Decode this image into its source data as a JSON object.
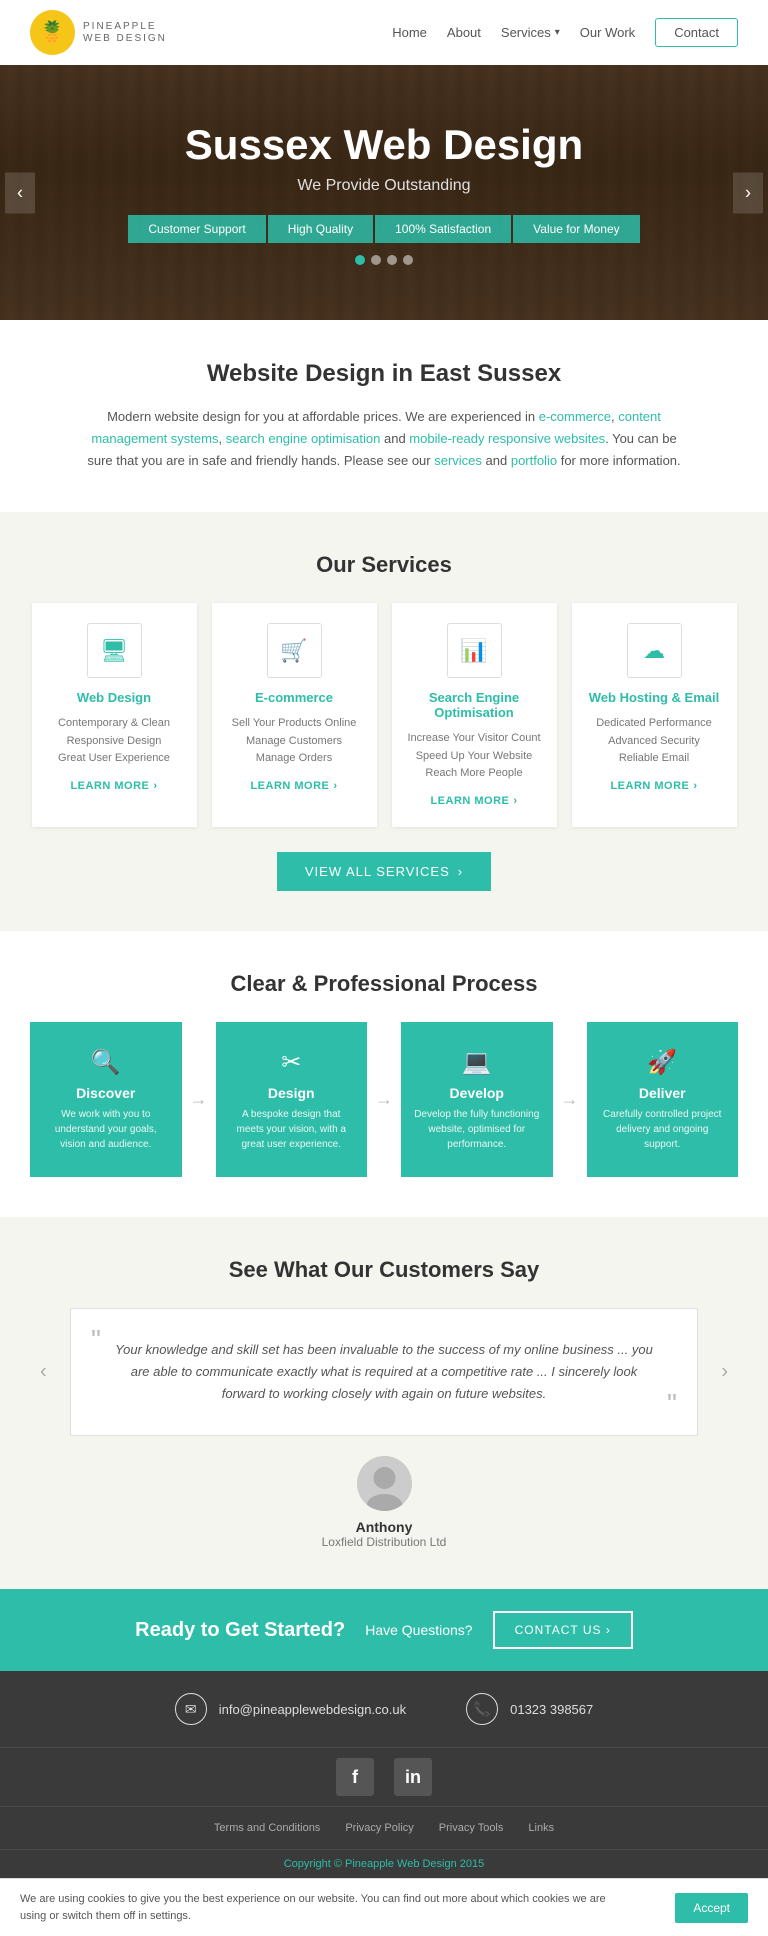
{
  "nav": {
    "logo_text": "PINEAPPLE",
    "logo_subtext": "WEB DESIGN",
    "logo_emoji": "🍍",
    "links": [
      {
        "label": "Home",
        "href": "#"
      },
      {
        "label": "About",
        "href": "#"
      },
      {
        "label": "Services",
        "href": "#"
      },
      {
        "label": "Our Work",
        "href": "#"
      }
    ],
    "contact_label": "Contact"
  },
  "hero": {
    "title": "Sussex Web Design",
    "subtitle": "We Provide Outstanding",
    "badges": [
      "Customer Support",
      "High Quality",
      "100% Satisfaction",
      "Value for Money"
    ],
    "prev_label": "‹",
    "next_label": "›"
  },
  "about": {
    "title": "Website Design in East Sussex",
    "text1": "Modern website design for you at affordable prices. We are experienced in ",
    "link1": "e-commerce",
    "text2": ", ",
    "link2": "content management systems",
    "text3": ", ",
    "link3": "search engine optimisation",
    "text4": " and ",
    "link4": "mobile-ready responsive websites",
    "text5": ". You can be sure that you are in safe and friendly hands. Please see our ",
    "link5": "services",
    "text6": " and ",
    "link6": "portfolio",
    "text7": " for more information."
  },
  "services": {
    "title": "Our Services",
    "cards": [
      {
        "icon": "🖥",
        "title": "Web Design",
        "lines": [
          "Contemporary & Clean",
          "Responsive Design",
          "Great User Experience"
        ],
        "learn_more": "LEARN MORE"
      },
      {
        "icon": "🛒",
        "title": "E-commerce",
        "lines": [
          "Sell Your Products Online",
          "Manage Customers",
          "Manage Orders"
        ],
        "learn_more": "LEARN MORE"
      },
      {
        "icon": "📊",
        "title": "Search Engine Optimisation",
        "lines": [
          "Increase Your Visitor Count",
          "Speed Up Your Website",
          "Reach More People"
        ],
        "learn_more": "LEARN MORE"
      },
      {
        "icon": "☁",
        "title": "Web Hosting & Email",
        "lines": [
          "Dedicated Performance",
          "Advanced Security",
          "Reliable Email"
        ],
        "learn_more": "LEARN MORE"
      }
    ],
    "view_all": "VIEW ALL SERVICES"
  },
  "process": {
    "title": "Clear & Professional Process",
    "steps": [
      {
        "icon": "🔍",
        "title": "Discover",
        "desc": "We work with you to understand your goals, vision and audience."
      },
      {
        "icon": "✂",
        "title": "Design",
        "desc": "A bespoke design that meets your vision, with a great user experience."
      },
      {
        "icon": "💻",
        "title": "Develop",
        "desc": "Develop the fully functioning website, optimised for performance."
      },
      {
        "icon": "🚀",
        "title": "Deliver",
        "desc": "Carefully controlled project delivery and ongoing support."
      }
    ],
    "arrow": "→"
  },
  "testimonials": {
    "title": "See What Our Customers Say",
    "quote": "Your knowledge and skill set has been invaluable to the success of my online business ... you are able to communicate exactly what is required at a competitive rate ... I sincerely look forward to working closely with again on future websites.",
    "author_name": "Anthony",
    "author_company": "Loxfield Distribution Ltd",
    "prev": "‹",
    "next": "›"
  },
  "cta": {
    "heading": "Ready to Get Started?",
    "question": "Have Questions?",
    "button_label": "CONTACT US ›"
  },
  "footer": {
    "email_icon": "✉",
    "email": "info@pineapplewebdesign.co.uk",
    "phone_icon": "📞",
    "phone": "01323 398567",
    "facebook_label": "f",
    "linkedin_label": "in",
    "links": [
      "Terms and Conditions",
      "Privacy Policy",
      "Privacy Tools",
      "Links"
    ],
    "copyright": "Copyright © Pineapple Web Design 2015"
  },
  "cookie": {
    "text": "We are using cookies to give you the best experience on our website. You can find out more about which cookies we are using or switch them off in settings.",
    "settings_label": "settings",
    "accept_label": "Accept"
  }
}
